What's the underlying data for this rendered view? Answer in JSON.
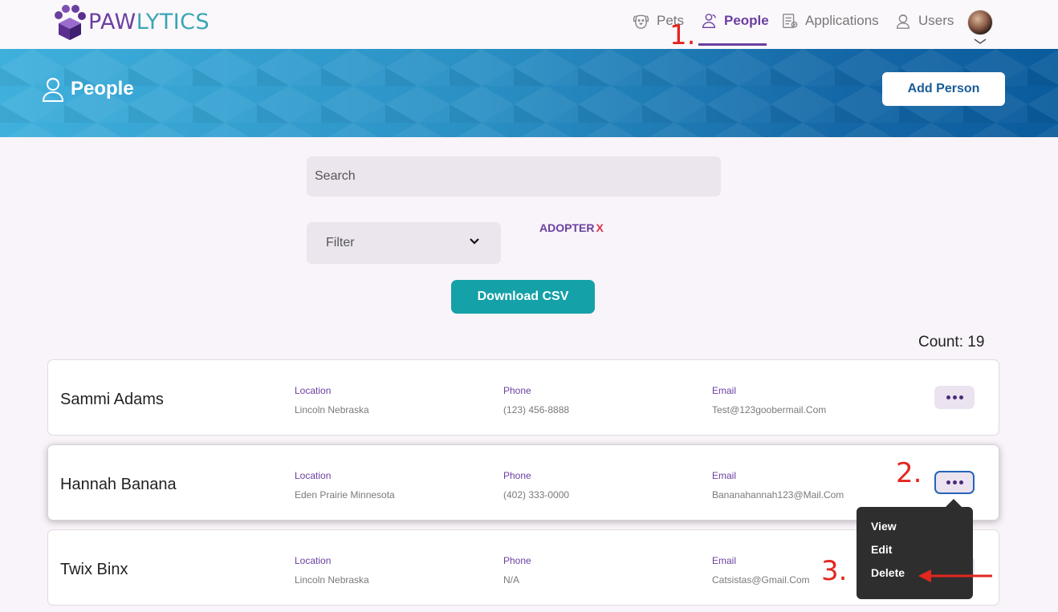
{
  "brand": {
    "name_part1": "PAW",
    "name_part2": "LYTICS",
    "purple": "#6b3fa0",
    "teal": "#3aa6b5"
  },
  "nav": {
    "items": [
      {
        "label": "Pets",
        "icon": "dog-icon"
      },
      {
        "label": "People",
        "icon": "people-icon",
        "active": true
      },
      {
        "label": "Applications",
        "icon": "application-icon"
      },
      {
        "label": "Users",
        "icon": "user-icon"
      }
    ]
  },
  "banner": {
    "title": "People",
    "add_button": "Add Person"
  },
  "search": {
    "placeholder": "Search"
  },
  "filter": {
    "label": "Filter",
    "active_tag": "ADOPTER",
    "remove_tag": "X"
  },
  "download_label": "Download CSV",
  "count_label": "Count: 19",
  "columns": {
    "location": "Location",
    "phone": "Phone",
    "email": "Email"
  },
  "people": [
    {
      "name": "Sammi Adams",
      "location": "Lincoln Nebraska",
      "phone": "(123) 456-8888",
      "email": "Test@123goobermail.Com"
    },
    {
      "name": "Hannah Banana",
      "location": "Eden Prairie Minnesota",
      "phone": "(402) 333-0000",
      "email": "Bananahannah123@Mail.Com"
    },
    {
      "name": "Twix Binx",
      "location": "Lincoln Nebraska",
      "phone": "N/A",
      "email": "Catsistas@Gmail.Com"
    }
  ],
  "menu": {
    "items": [
      "View",
      "Edit",
      "Delete"
    ]
  },
  "annotations": {
    "step1": "1.",
    "step2": "2.",
    "step3": "3."
  },
  "colors": {
    "accent": "#6b3fa0",
    "download": "#14a1a7",
    "annotation": "#e3261f"
  }
}
